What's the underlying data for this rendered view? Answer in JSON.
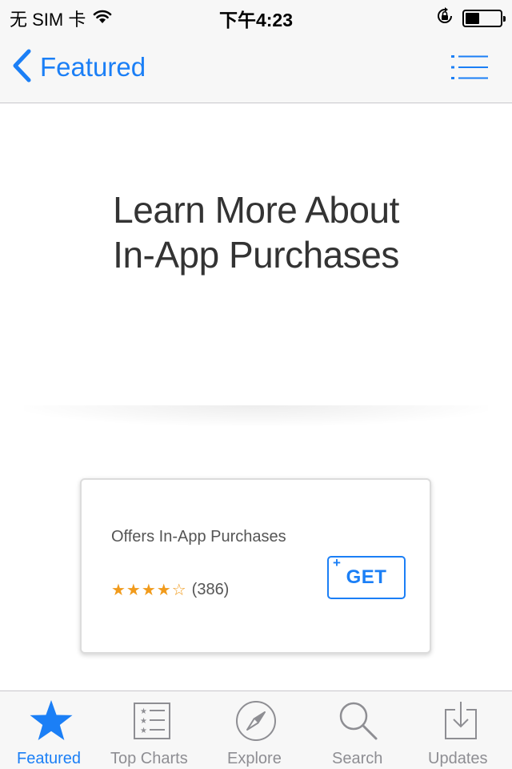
{
  "status_bar": {
    "carrier": "无 SIM 卡",
    "time": "下午4:23",
    "battery_level": 0.4,
    "icons": [
      "wifi-icon",
      "rotation-lock-icon",
      "battery-icon"
    ]
  },
  "nav": {
    "back_label": "Featured",
    "back_icon": "chevron-left-icon",
    "list_icon": "list-icon"
  },
  "banner": {
    "title_line1": "Learn More About",
    "title_line2": "In-App Purchases"
  },
  "card": {
    "subtitle": "Offers In-App Purchases",
    "stars": "★★★★☆",
    "rating_value": 4,
    "rating_count": "(386)",
    "get_label": "GET",
    "get_plus": "+"
  },
  "tabs": [
    {
      "label": "Featured",
      "icon": "star-icon",
      "active": true
    },
    {
      "label": "Top Charts",
      "icon": "top-charts-icon",
      "active": false
    },
    {
      "label": "Explore",
      "icon": "compass-icon",
      "active": false
    },
    {
      "label": "Search",
      "icon": "search-icon",
      "active": false
    },
    {
      "label": "Updates",
      "icon": "updates-icon",
      "active": false
    }
  ],
  "colors": {
    "accent": "#1b7ff6",
    "star": "#f19b1c",
    "inactive": "#8e8e93",
    "bar_bg": "#f7f7f7"
  }
}
